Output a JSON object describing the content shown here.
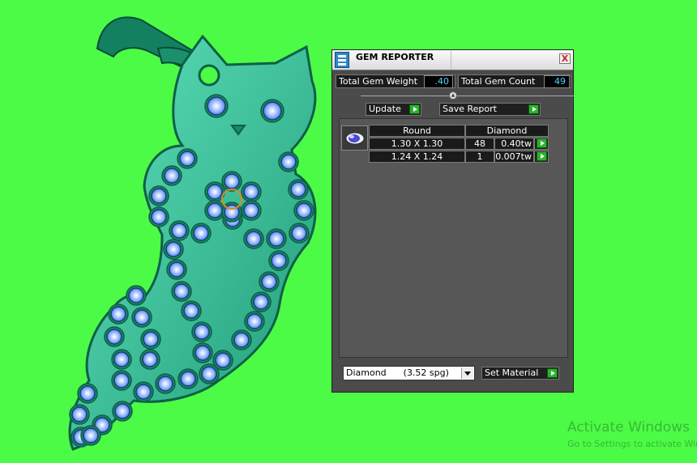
{
  "panel": {
    "title": "GEM REPORTER",
    "close_label": "X",
    "total_gem_weight_label": "Total Gem Weight",
    "total_gem_weight_value": ".40",
    "total_gem_count_label": "Total Gem Count",
    "total_gem_count_value": "49",
    "update_label": "Update",
    "save_report_label": "Save Report",
    "table": {
      "headers": [
        "Round",
        "Diamond"
      ],
      "rows": [
        {
          "size": "1.30 X 1.30",
          "count": "48",
          "weight": "0.40tw"
        },
        {
          "size": "1.24 X 1.24",
          "count": "1",
          "weight": "0.007tw"
        }
      ]
    },
    "material_select_value": "Diamond      (3.52 spg)",
    "set_material_label": "Set Material"
  },
  "watermark": {
    "line1": "Activate Windows",
    "line2": "Go to Settings to activate Windows."
  },
  "colors": {
    "background": "#4cfb46",
    "pendant": "#2fc79a",
    "gem": "#7ea8ff",
    "panel": "#4b4b4b",
    "value_text": "#4fd4ff",
    "go_button": "#2cb22c"
  }
}
